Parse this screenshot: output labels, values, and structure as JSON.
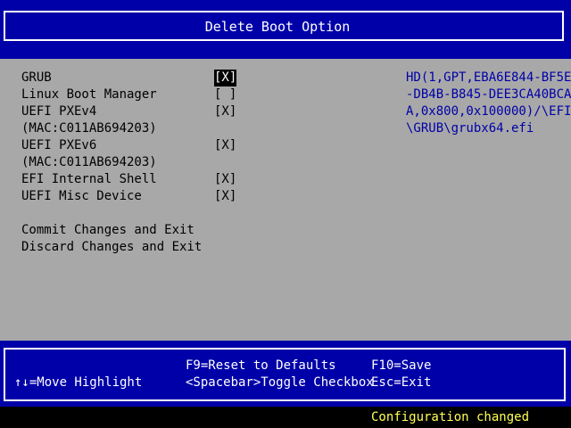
{
  "header": {
    "title": "Delete Boot Option"
  },
  "options": [
    {
      "label": "GRUB",
      "check": "[X]",
      "selected": true
    },
    {
      "label": "Linux Boot Manager",
      "check": "[ ]",
      "selected": false
    },
    {
      "label": "UEFI PXEv4",
      "check": "[X]",
      "selected": false
    },
    {
      "label": "(MAC:C011AB694203)",
      "check": "",
      "selected": false
    },
    {
      "label": "UEFI PXEv6",
      "check": "[X]",
      "selected": false
    },
    {
      "label": "(MAC:C011AB694203)",
      "check": "",
      "selected": false
    },
    {
      "label": "EFI Internal Shell",
      "check": "[X]",
      "selected": false
    },
    {
      "label": "UEFI Misc Device",
      "check": "[X]",
      "selected": false
    }
  ],
  "actions": {
    "commit": "Commit Changes and Exit",
    "discard": "Discard Changes and Exit"
  },
  "help_text": [
    "HD(1,GPT,EBA6E844-BF5E",
    "-DB4B-B845-DEE3CA40BCA",
    "A,0x800,0x100000)/\\EFI",
    "\\GRUB\\grubx64.efi"
  ],
  "footer": {
    "reset": "F9=Reset to Defaults",
    "save": "F10=Save",
    "move": "↑↓=Move Highlight",
    "toggle": "<Spacebar>Toggle Checkbox",
    "exit": "Esc=Exit"
  },
  "status": {
    "message": "Configuration changed"
  }
}
